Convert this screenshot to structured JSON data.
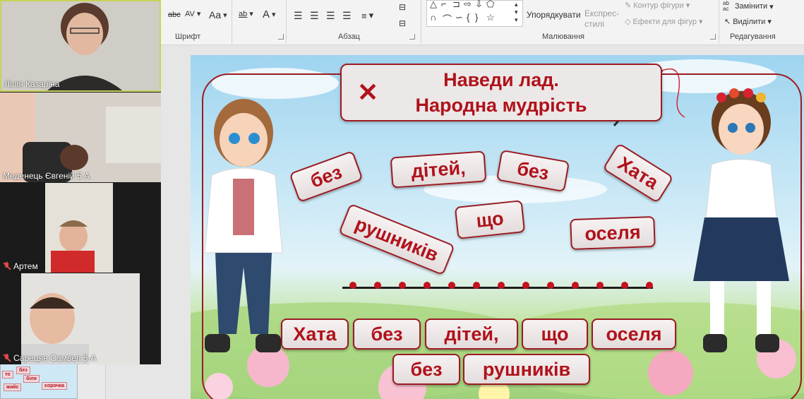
{
  "ribbon": {
    "font_group_label": "Шрифт",
    "paragraph_group_label": "Абзац",
    "drawing_group_label": "Малювання",
    "editing_group_label": "Редагування",
    "arrange_label": "Упорядкувати",
    "quick_styles_label": "Експрес-",
    "quick_styles_label2": "стилі",
    "shape_outline_label": "Контур фігури",
    "shape_effects_label": "Ефекти для фігур",
    "replace_label": "Замінити",
    "select_label": "Виділити",
    "font_size_label": "Aa",
    "font_color_label": "A",
    "char_spacing_label": "AV",
    "strike_label": "abc",
    "replace_icon_text": "ab ac"
  },
  "participants": [
    {
      "name": "Лілія Казаріна",
      "muted": false
    },
    {
      "name": "Меденець Євгеній 5 А",
      "muted": false
    },
    {
      "name": "Артем",
      "muted": true
    },
    {
      "name": "Сарецян Самвел 5-А",
      "muted": true
    }
  ],
  "thumbnail_words": [
    "то",
    "без",
    "біля",
    "сорочка",
    "жийс"
  ],
  "slide": {
    "title_line1": "Наведи лад.",
    "title_line2": "Народна мудрість",
    "scattered_words": [
      "без",
      "дітей,",
      "без",
      "Хата",
      "рушників",
      "що",
      "оселя"
    ],
    "answer_row1": [
      "Хата",
      "без",
      "дітей,",
      "що",
      "оселя"
    ],
    "answer_row2": [
      "без",
      "рушників"
    ]
  },
  "colors": {
    "accent": "#b0121b",
    "card_border": "#9b1b22",
    "ribbon_bg": "#f3f3f3"
  }
}
